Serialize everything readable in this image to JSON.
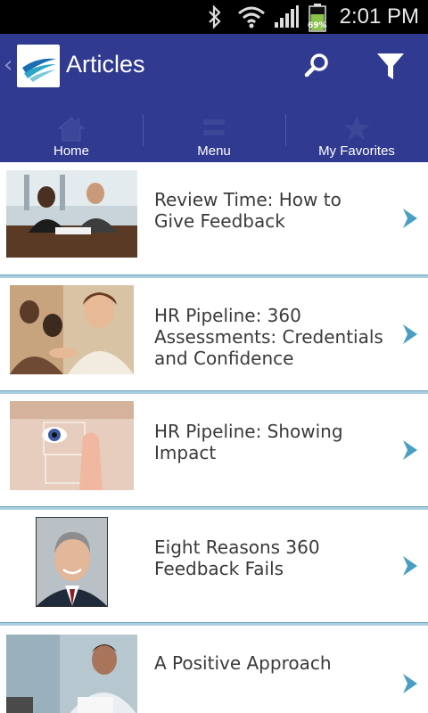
{
  "status_bar": {
    "time": "2:01 PM",
    "battery_percent": "69%",
    "icons": [
      "bluetooth-icon",
      "wifi-icon",
      "signal-icon",
      "battery-icon"
    ]
  },
  "header": {
    "title": "Articles",
    "brand_color": "#2f3a90",
    "back_icon": "back-chevron-icon",
    "actions": [
      "search-icon",
      "filter-icon"
    ]
  },
  "tabs": [
    {
      "label": "Home",
      "icon": "home-icon"
    },
    {
      "label": "Menu",
      "icon": "menu-icon"
    },
    {
      "label": "My Favorites",
      "icon": "star-icon"
    }
  ],
  "articles": [
    {
      "title": "Review Time: How to Give Feedback"
    },
    {
      "title": "HR Pipeline: 360 Assessments: Credentials and Confidence"
    },
    {
      "title": "HR Pipeline: Showing Impact"
    },
    {
      "title": "Eight Reasons 360 Feedback Fails"
    },
    {
      "title": "A Positive Approach"
    }
  ],
  "colors": {
    "divider": "#a9cfe0",
    "chevron": "#4a9ec4",
    "title_text": "#3a3a3a"
  }
}
